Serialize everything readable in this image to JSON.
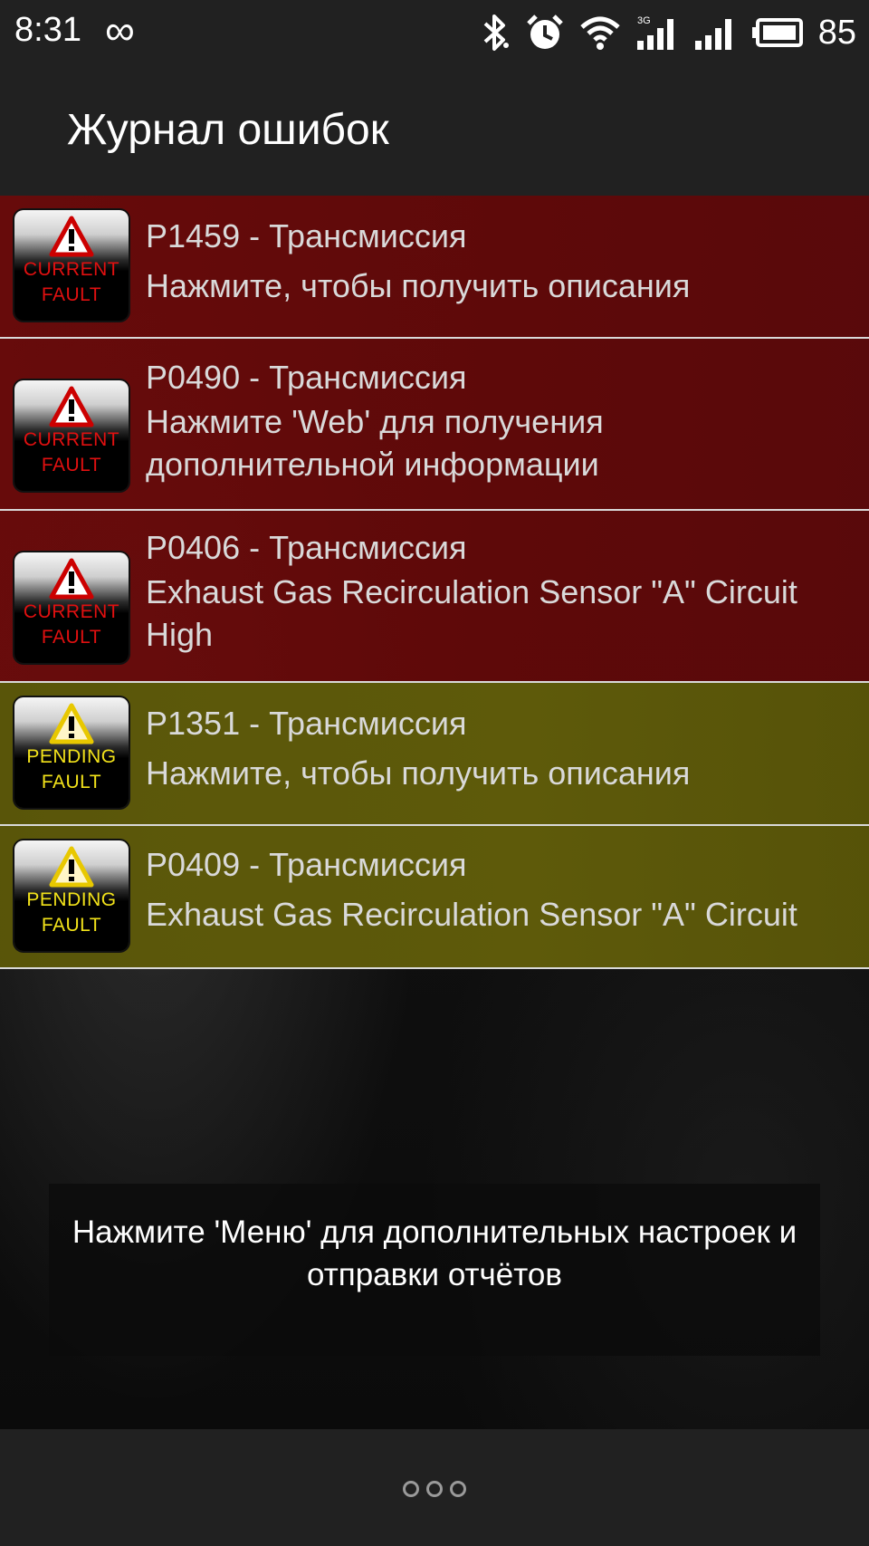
{
  "status_bar": {
    "time": "8:31",
    "battery_percent": "85",
    "icons": [
      "infinity-icon",
      "bluetooth-icon",
      "alarm-icon",
      "wifi-icon",
      "3g-signal-icon",
      "signal-icon",
      "battery-icon"
    ]
  },
  "app_bar": {
    "title": "Журнал ошибок"
  },
  "faults": [
    {
      "status": "current",
      "badge_line1": "CURRENT",
      "badge_line2": "FAULT",
      "code": "P1459 - Трансмиссия",
      "description": "Нажмите, чтобы получить описания"
    },
    {
      "status": "current",
      "badge_line1": "CURRENT",
      "badge_line2": "FAULT",
      "code": "P0490 - Трансмиссия",
      "description": "Нажмите 'Web' для получения дополнительной информации"
    },
    {
      "status": "current",
      "badge_line1": "CURRENT",
      "badge_line2": "FAULT",
      "code": "P0406 - Трансмиссия",
      "description": "Exhaust Gas Recirculation Sensor \"A\" Circuit High"
    },
    {
      "status": "pending",
      "badge_line1": "PENDING",
      "badge_line2": "FAULT",
      "code": "P1351 - Трансмиссия",
      "description": "Нажмите, чтобы получить описания"
    },
    {
      "status": "pending",
      "badge_line1": "PENDING",
      "badge_line2": "FAULT",
      "code": "P0409 - Трансмиссия",
      "description": "Exhaust Gas Recirculation Sensor \"A\" Circuit"
    }
  ],
  "toast": {
    "text": "Нажмите 'Меню' для дополнительных настроек и отправки отчётов"
  },
  "colors": {
    "current_fault_row": "#6b0a0a",
    "pending_fault_row": "#5e5a08",
    "bar_background": "#212121",
    "text_primary": "#d9d9d9"
  }
}
